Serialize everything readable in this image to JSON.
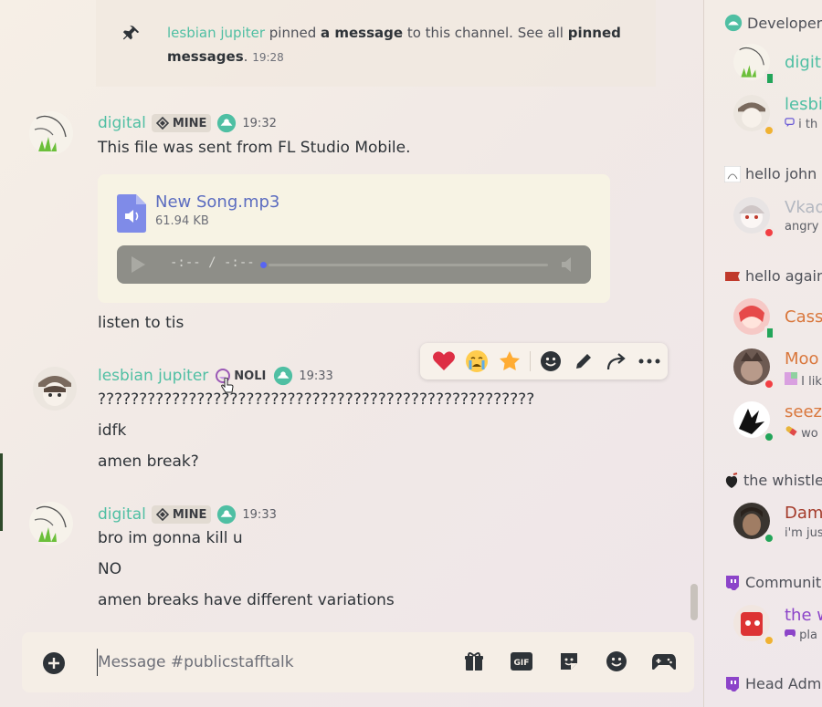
{
  "pinned": {
    "actor": "lesbian jupiter",
    "text_mid": " pinned ",
    "link1": "a message",
    "text_end": " to this channel. See all ",
    "link2": "pinned messages",
    "dot": ".",
    "time": "19:28"
  },
  "messages": [
    {
      "username": "digital",
      "tag": "MINE",
      "time": "19:32",
      "lines": [
        "This file was sent from FL Studio Mobile."
      ],
      "attachment": {
        "file_name": "New Song.mp3",
        "file_size": "61.94 KB",
        "player_time": "-:-- / -:--"
      },
      "after": [
        "listen to tis"
      ]
    },
    {
      "username": "lesbian jupiter",
      "tag": "NOLI",
      "time": "19:33",
      "lines": [
        "?????????????????????????????????????????????????????",
        "idfk",
        "amen break?"
      ]
    },
    {
      "username": "digital",
      "tag": "MINE",
      "time": "19:33",
      "lines": [
        "bro im gonna kill u",
        "NO",
        "amen breaks have different variations"
      ]
    }
  ],
  "toolbar": {
    "reactions": [
      "heart",
      "crying-face",
      "star"
    ],
    "actions": [
      "add-reaction-icon",
      "edit-icon",
      "forward-icon",
      "more-icon"
    ]
  },
  "composer": {
    "placeholder": "Message #publicstafftalk",
    "icons": [
      "gift-icon",
      "gif-icon",
      "sticker-icon",
      "emoji-icon",
      "game-icon"
    ],
    "gif_label": "GIF"
  },
  "right_panel": {
    "sections": [
      {
        "label": "Developer"
      },
      {
        "label": "hello john d"
      },
      {
        "label": "hello again"
      },
      {
        "label": "the whistle"
      },
      {
        "label": "Communit"
      },
      {
        "label": "Head Adm"
      }
    ],
    "members": [
      {
        "name": "digit",
        "sub": "",
        "color": "#4fbfa3",
        "status": "mobile"
      },
      {
        "name": "lesbi",
        "sub": "i th",
        "color": "#4fbfa3",
        "status": "idle"
      },
      {
        "name": "Vkad",
        "sub": "angry",
        "color": "#b3b7c0",
        "status": "dnd"
      },
      {
        "name": "Cass",
        "sub": "",
        "color": "#d9773c",
        "status": "mobile"
      },
      {
        "name": "Moo",
        "sub": "I lik",
        "color": "#d9773c",
        "status": "dnd"
      },
      {
        "name": "seez",
        "sub": "wo",
        "color": "#d9773c",
        "status": "online"
      },
      {
        "name": "Dam",
        "sub": "i'm jus",
        "color": "#a43a2a",
        "status": "online"
      },
      {
        "name": "the w",
        "sub": "pla",
        "color": "#8c44c9",
        "status": "idle"
      }
    ]
  },
  "colors": {
    "accent_green": "#4fbfa3",
    "blurple": "#5865f2",
    "online": "#23a55a",
    "idle": "#f0b232",
    "dnd": "#f23f43"
  }
}
